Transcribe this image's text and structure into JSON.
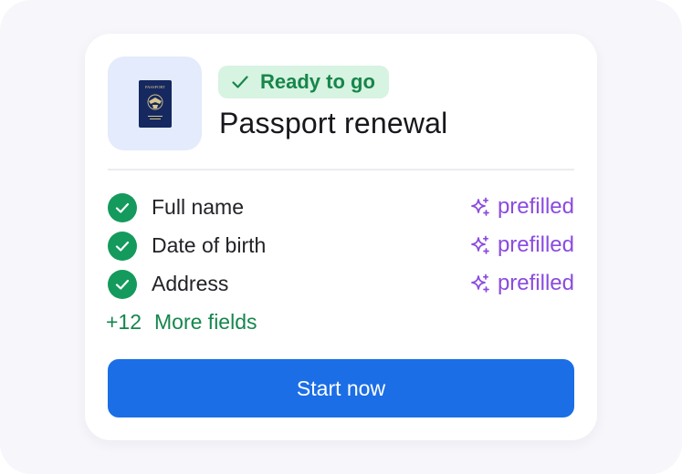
{
  "card": {
    "badge": {
      "icon": "check-icon",
      "label": "Ready to go",
      "color": "#17864b",
      "background": "#d7f3e1"
    },
    "title": "Passport renewal",
    "document_icon": "passport-icon",
    "document_icon_text": "PASSPORT",
    "fields": [
      {
        "label": "Full name",
        "status_icon": "sparkle-icon",
        "status": "prefilled"
      },
      {
        "label": "Date of birth",
        "status_icon": "sparkle-icon",
        "status": "prefilled"
      },
      {
        "label": "Address",
        "status_icon": "sparkle-icon",
        "status": "prefilled"
      }
    ],
    "more_fields": {
      "count": "+12",
      "label": "More fields"
    },
    "cta": {
      "label": "Start now",
      "color": "#1b6ee6"
    }
  },
  "colors": {
    "check": "#149a5c",
    "prefilled": "#8a4be0",
    "more": "#15864d",
    "tile": "#e3ebfc"
  }
}
